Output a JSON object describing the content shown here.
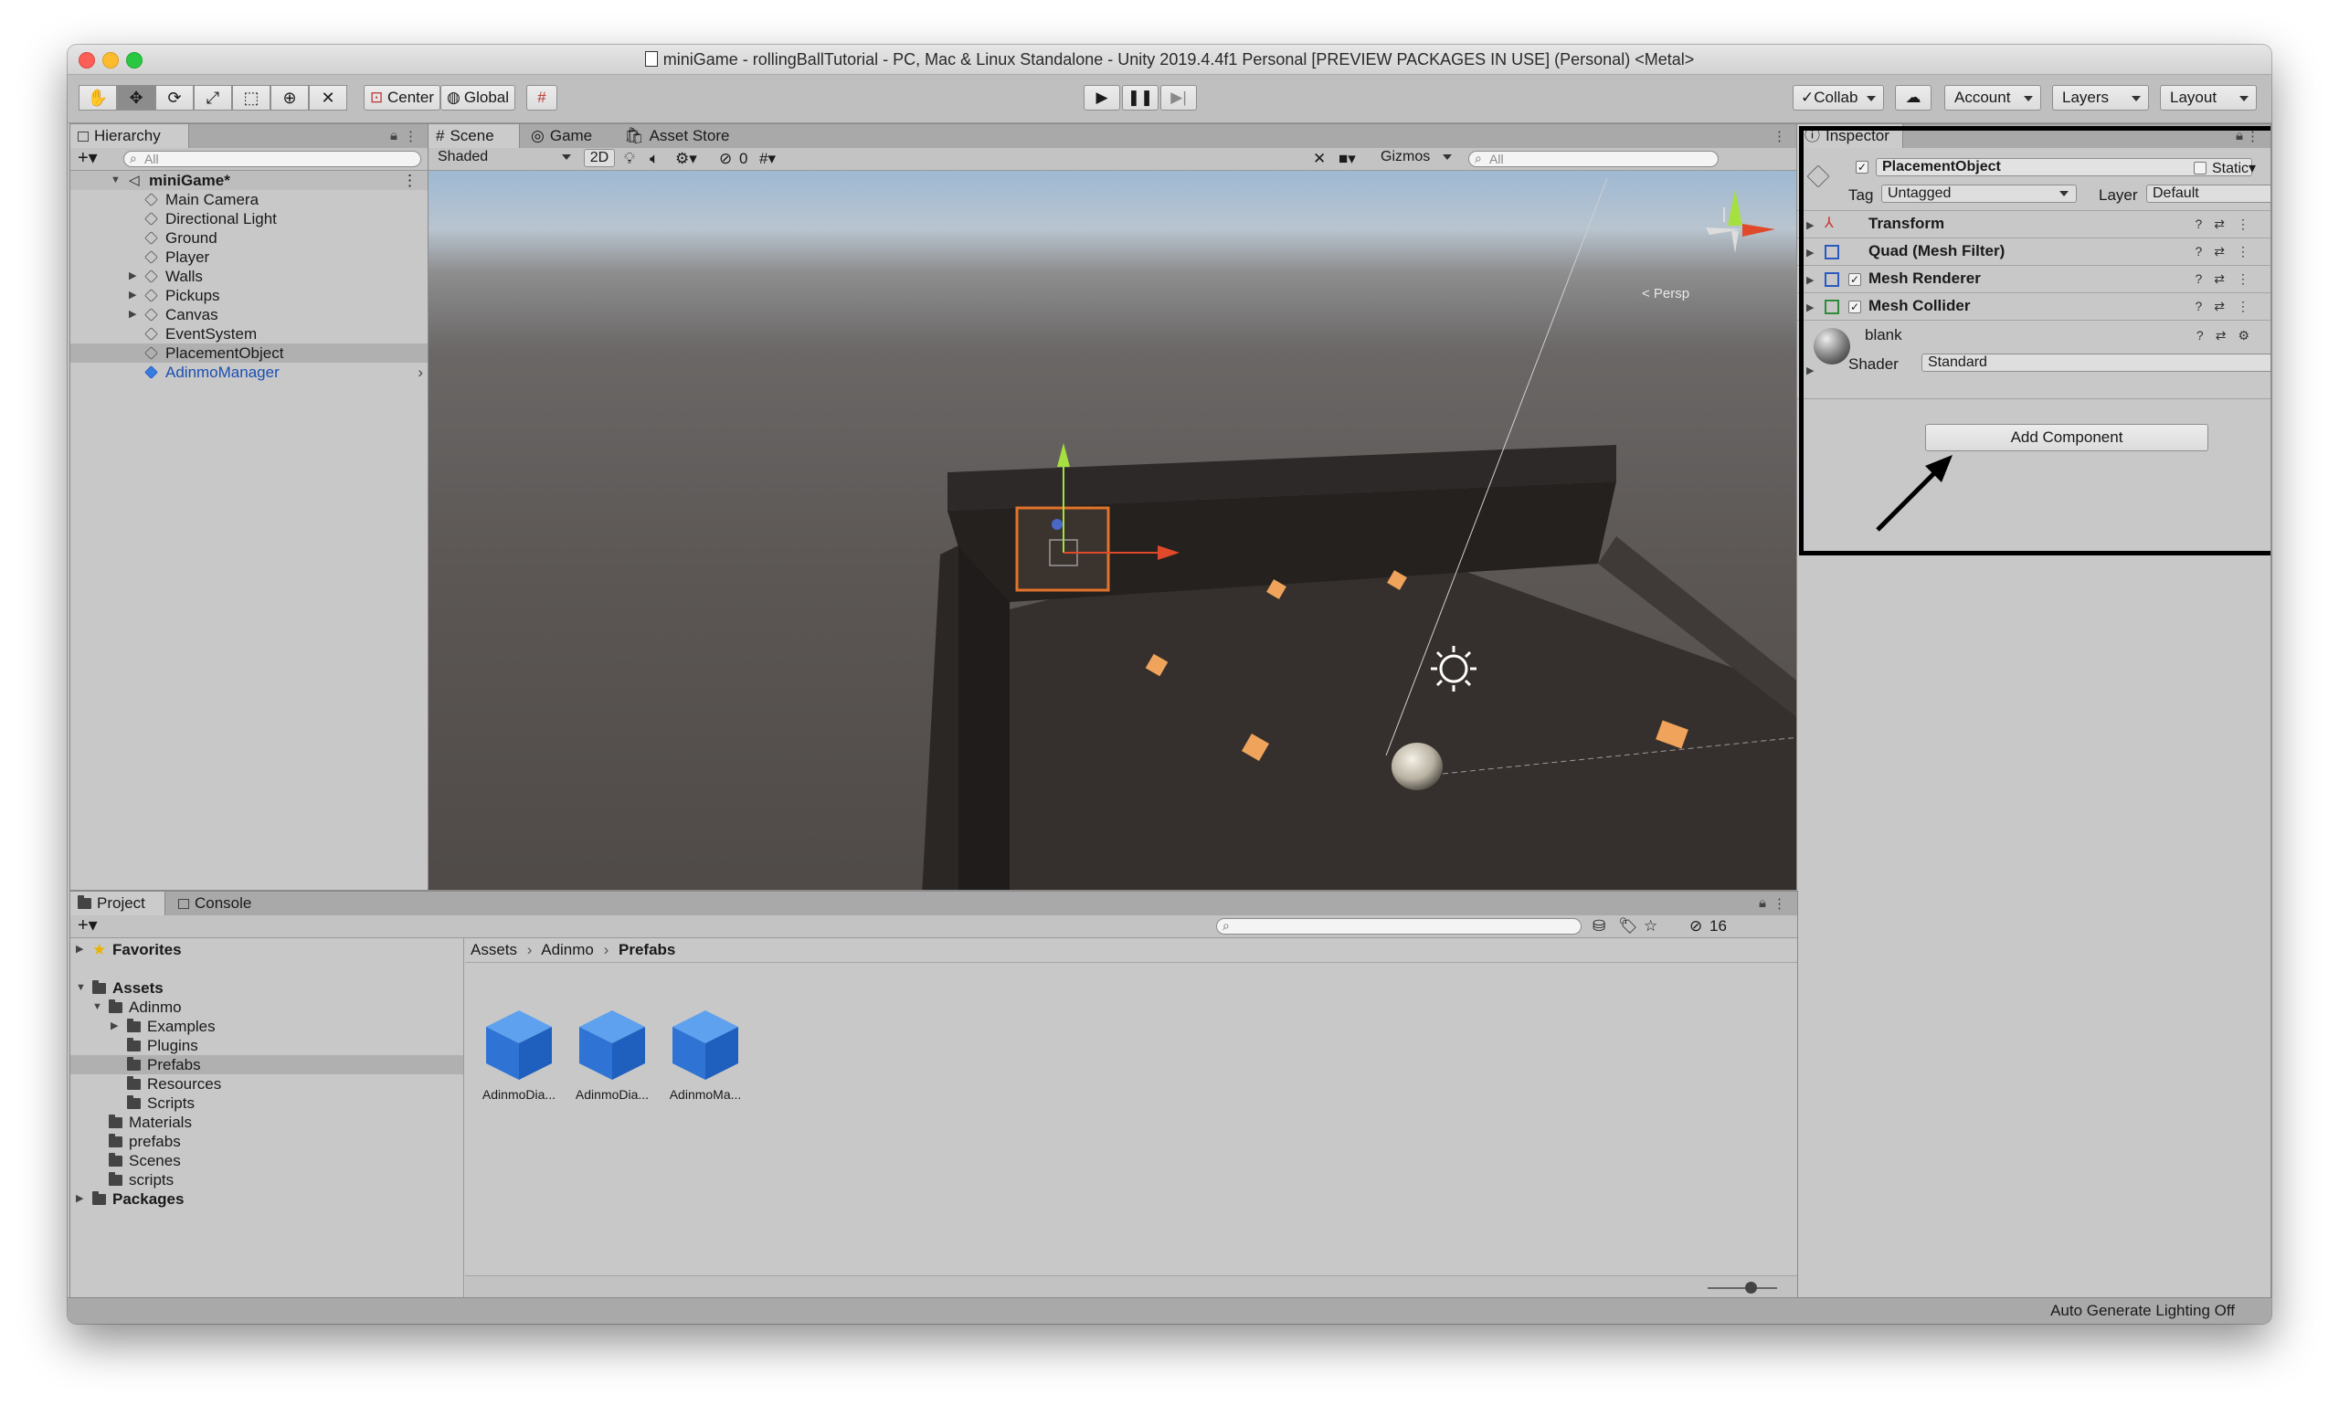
{
  "window": {
    "title": "miniGame - rollingBallTutorial - PC, Mac & Linux Standalone - Unity 2019.4.4f1 Personal [PREVIEW PACKAGES IN USE] (Personal) <Metal>"
  },
  "toolbar": {
    "tools": [
      "hand-tool-icon",
      "move-tool-icon",
      "rotate-tool-icon",
      "scale-tool-icon",
      "rect-tool-icon",
      "transform-tool-icon",
      "custom-tool-icon"
    ],
    "pivot_label": "Center",
    "space_label": "Global",
    "collab_label": "Collab",
    "account_label": "Account",
    "layers_label": "Layers",
    "layout_label": "Layout"
  },
  "hierarchy": {
    "tab_label": "Hierarchy",
    "search_placeholder": "All",
    "scene_name": "miniGame*",
    "items": [
      {
        "label": "Main Camera"
      },
      {
        "label": "Directional Light"
      },
      {
        "label": "Ground"
      },
      {
        "label": "Player"
      },
      {
        "label": "Walls"
      },
      {
        "label": "Pickups"
      },
      {
        "label": "Canvas"
      },
      {
        "label": "EventSystem"
      },
      {
        "label": "PlacementObject"
      },
      {
        "label": "AdinmoManager"
      }
    ]
  },
  "scene": {
    "tabs": [
      {
        "label": "Scene"
      },
      {
        "label": "Game"
      },
      {
        "label": "Asset Store"
      }
    ],
    "shading_mode": "Shaded",
    "mode_2d": "2D",
    "hidden_count": "0",
    "gizmos_label": "Gizmos",
    "search_placeholder": "All",
    "persp_label": "< Persp"
  },
  "inspector": {
    "tab_label": "Inspector",
    "object_name": "PlacementObject",
    "static_label": "Static",
    "tag_label": "Tag",
    "tag_value": "Untagged",
    "layer_label": "Layer",
    "layer_value": "Default",
    "components": [
      {
        "label": "Transform"
      },
      {
        "label": "Quad (Mesh Filter)"
      },
      {
        "label": "Mesh Renderer"
      },
      {
        "label": "Mesh Collider"
      }
    ],
    "material_name": "blank",
    "shader_label": "Shader",
    "shader_value": "Standard",
    "add_component_label": "Add Component",
    "highlight_color": "#000000"
  },
  "project": {
    "tabs": [
      {
        "label": "Project"
      },
      {
        "label": "Console"
      }
    ],
    "hidden_count": "16",
    "favorites_label": "Favorites",
    "assets_label": "Assets",
    "tree": [
      {
        "label": "Adinmo"
      },
      {
        "label": "Examples"
      },
      {
        "label": "Plugins"
      },
      {
        "label": "Prefabs"
      },
      {
        "label": "Resources"
      },
      {
        "label": "Scripts"
      },
      {
        "label": "Materials"
      },
      {
        "label": "prefabs"
      },
      {
        "label": "Scenes"
      },
      {
        "label": "scripts"
      }
    ],
    "packages_label": "Packages",
    "breadcrumb": [
      {
        "label": "Assets"
      },
      {
        "label": "Adinmo"
      },
      {
        "label": "Prefabs"
      }
    ],
    "breadcrumb_sep": "›",
    "prefabs": [
      {
        "label": "AdinmoDia..."
      },
      {
        "label": "AdinmoDia..."
      },
      {
        "label": "AdinmoMa..."
      }
    ]
  },
  "status": {
    "lighting": "Auto Generate Lighting Off"
  }
}
